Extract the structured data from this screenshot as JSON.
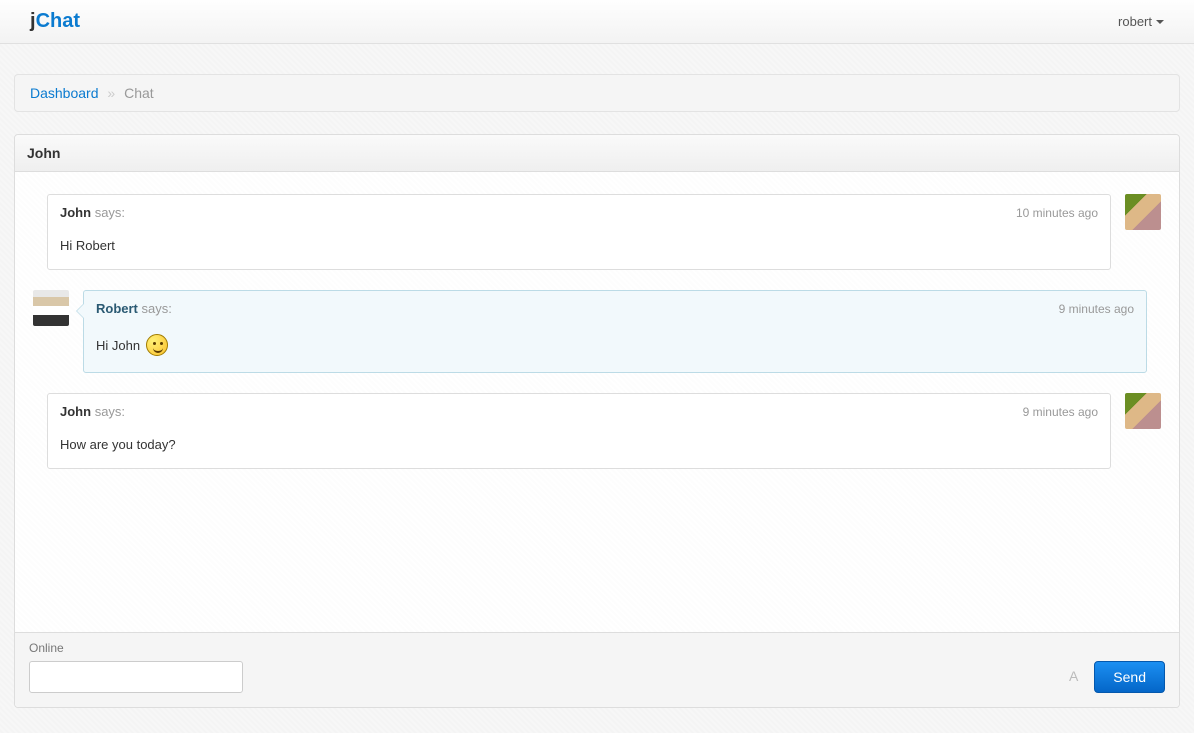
{
  "navbar": {
    "brand_j": "j",
    "brand_rest": "Chat",
    "user": "robert"
  },
  "breadcrumb": {
    "root": "Dashboard",
    "divider": "»",
    "current": "Chat"
  },
  "panel": {
    "title": "John"
  },
  "messages": [
    {
      "author": "John",
      "says": "says:",
      "time": "10 minutes ago",
      "text": "Hi Robert",
      "self": false
    },
    {
      "author": "Robert",
      "says": "says:",
      "time": "9 minutes ago",
      "text": "Hi John",
      "self": true,
      "emoji": true
    },
    {
      "author": "John",
      "says": "says:",
      "time": "9 minutes ago",
      "text": "How are you today?",
      "self": false
    }
  ],
  "footer": {
    "status": "Online",
    "placeholder": "",
    "send": "Send"
  }
}
